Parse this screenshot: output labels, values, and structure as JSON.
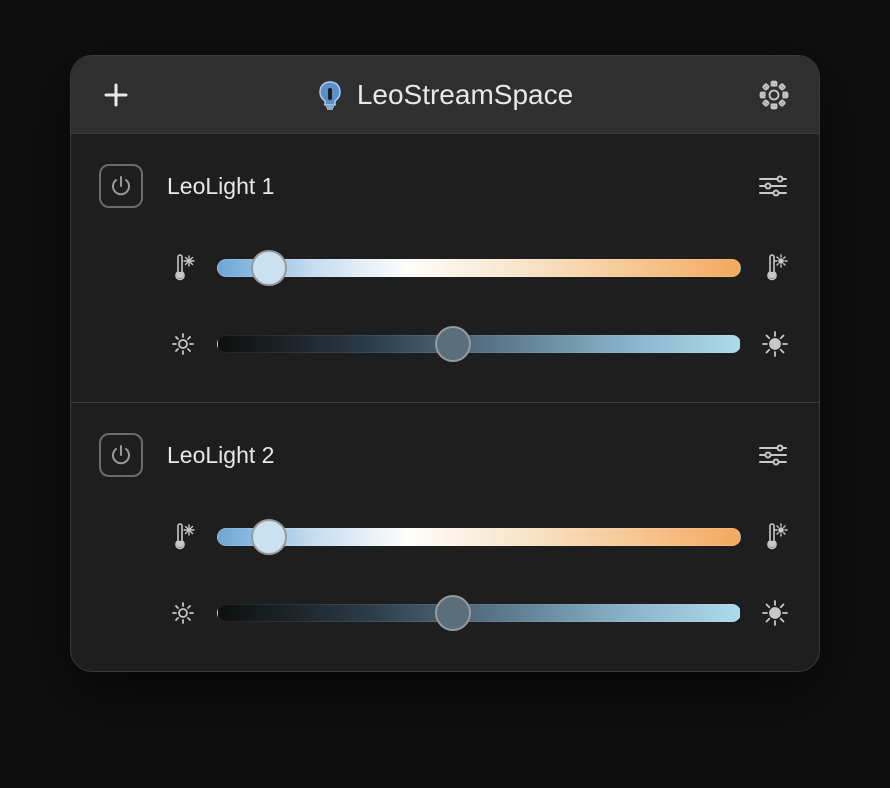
{
  "header": {
    "title": "LeoStreamSpace"
  },
  "lights": [
    {
      "name": "LeoLight 1",
      "power": true,
      "temperature": 10,
      "brightness": 45
    },
    {
      "name": "LeoLight 2",
      "power": true,
      "temperature": 10,
      "brightness": 45
    }
  ]
}
